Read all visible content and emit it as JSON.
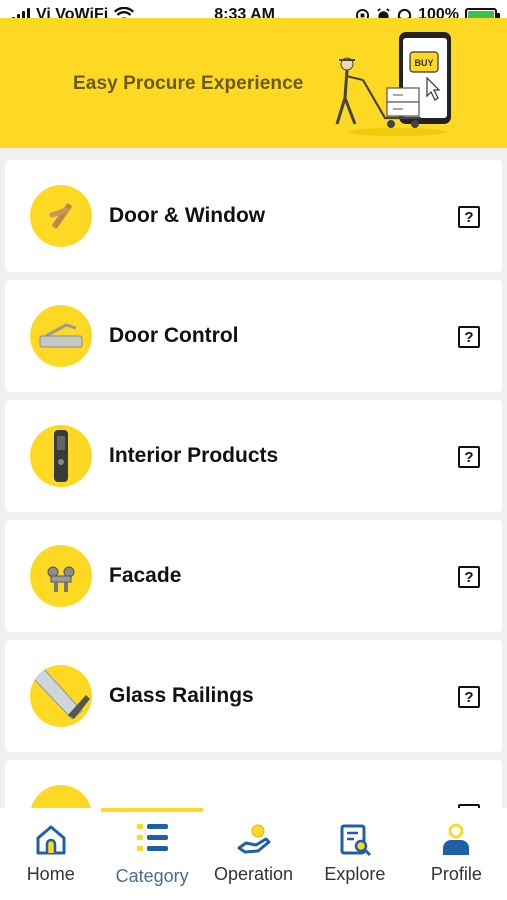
{
  "status_bar": {
    "carrier": "Vi VoWiFi",
    "time": "8:33 AM",
    "battery": "100%"
  },
  "banner": {
    "tagline": "Easy Procure Experience",
    "buy_label": "BUY"
  },
  "categories": [
    {
      "label": "Door & Window",
      "icon": "door-handle-icon"
    },
    {
      "label": "Door Control",
      "icon": "door-closer-icon"
    },
    {
      "label": "Interior Products",
      "icon": "digital-lock-icon"
    },
    {
      "label": "Facade",
      "icon": "facade-fitting-icon"
    },
    {
      "label": "Glass Railings",
      "icon": "glass-railing-icon"
    }
  ],
  "help_glyph": "?",
  "nav": {
    "items": [
      {
        "label": "Home",
        "icon": "home-icon"
      },
      {
        "label": "Category",
        "icon": "category-list-icon"
      },
      {
        "label": "Operation",
        "icon": "operation-hand-icon"
      },
      {
        "label": "Explore",
        "icon": "explore-search-icon"
      },
      {
        "label": "Profile",
        "icon": "profile-icon"
      }
    ],
    "active_index": 1
  },
  "colors": {
    "brand_yellow": "#fdd923",
    "nav_blue": "#1f5fa6",
    "active_label": "#4a6b9a"
  }
}
